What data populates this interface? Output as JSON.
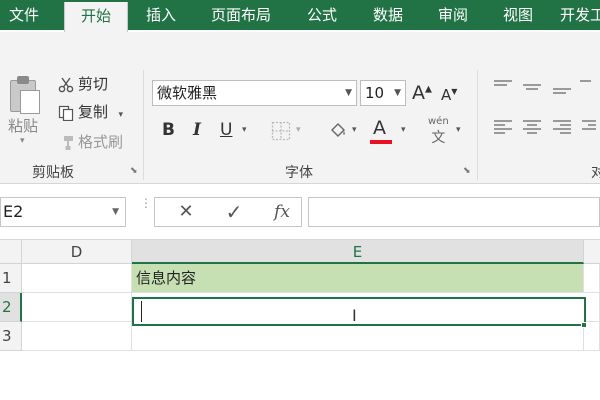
{
  "tabs": [
    {
      "label": "文件",
      "active": false
    },
    {
      "label": "开始",
      "active": true
    },
    {
      "label": "插入",
      "active": false
    },
    {
      "label": "页面布局",
      "active": false
    },
    {
      "label": "公式",
      "active": false
    },
    {
      "label": "数据",
      "active": false
    },
    {
      "label": "审阅",
      "active": false
    },
    {
      "label": "视图",
      "active": false
    },
    {
      "label": "开发工",
      "active": false
    }
  ],
  "clipboard": {
    "paste_label": "粘贴",
    "cut_label": "剪切",
    "copy_label": "复制",
    "format_painter_label": "格式刷",
    "group_label": "剪贴板"
  },
  "font": {
    "font_name": "微软雅黑",
    "font_size": "10",
    "bold": "B",
    "italic": "I",
    "underline": "U",
    "grow": "A",
    "shrink": "A",
    "color_letter": "A",
    "phonetic_top": "wén",
    "phonetic_bottom": "文",
    "group_label": "字体",
    "font_color": "#e81123"
  },
  "alignment": {
    "group_label_partial": "对"
  },
  "formula_bar": {
    "name_box": "E2",
    "cancel": "✕",
    "enter": "✓",
    "fx": "fx",
    "value": ""
  },
  "grid": {
    "columns": [
      "D",
      "E"
    ],
    "rows": [
      "1",
      "2",
      "3"
    ],
    "cells": {
      "E1": "信息内容",
      "E2": ""
    },
    "selected_column": "E",
    "selected_row": "2"
  },
  "colors": {
    "brand": "#217346",
    "highlight": "#c6e0b4"
  }
}
